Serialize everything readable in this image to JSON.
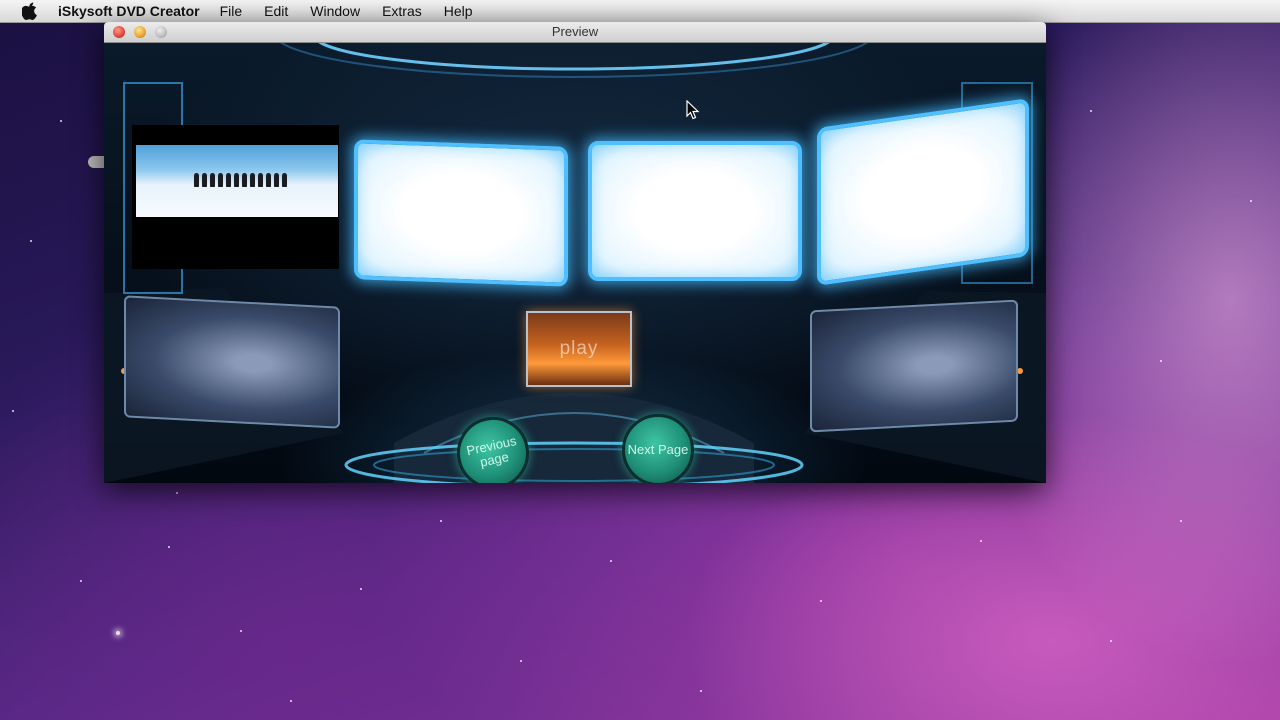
{
  "menubar": {
    "app_name": "iSkysoft DVD Creator",
    "items": [
      {
        "label": "File"
      },
      {
        "label": "Edit"
      },
      {
        "label": "Window"
      },
      {
        "label": "Extras"
      },
      {
        "label": "Help"
      }
    ]
  },
  "window": {
    "title": "Preview"
  },
  "dvd_menu": {
    "play_label": "play",
    "previous_page_label": "Previous page",
    "next_page_label": "Next Page"
  },
  "icons": {
    "apple": "apple-icon",
    "close": "close-icon",
    "minimize": "minimize-icon",
    "zoom": "zoom-icon",
    "cursor": "cursor-icon"
  },
  "colors": {
    "screen_glow": "#4fbfff",
    "play_orange": "#ff9a3a",
    "nav_green": "#1f8f78"
  }
}
